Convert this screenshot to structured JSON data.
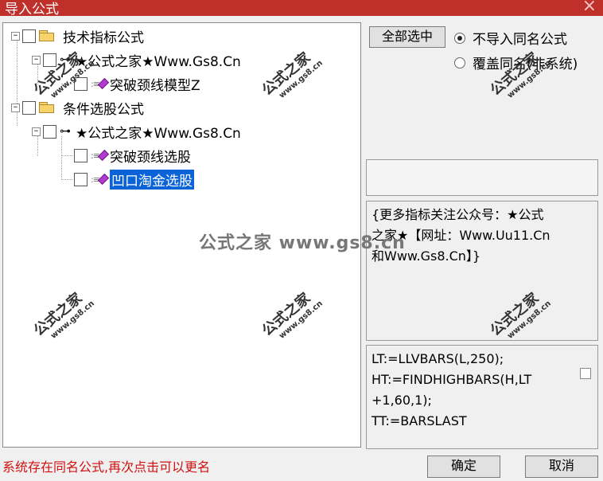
{
  "window": {
    "title": "导入公式",
    "close_glyph": "×"
  },
  "tree": {
    "items": [
      {
        "label": "技术指标公式",
        "type": "folder"
      },
      {
        "label": "★公式之家★Www.Gs8.Cn",
        "type": "group"
      },
      {
        "label": "突破颈线模型Z",
        "type": "formula"
      },
      {
        "label": "条件选股公式",
        "type": "folder"
      },
      {
        "label": "★公式之家★Www.Gs8.Cn",
        "type": "group"
      },
      {
        "label": "突破颈线选股",
        "type": "formula"
      },
      {
        "label": "凹口淘金选股",
        "type": "formula",
        "selected": true
      }
    ],
    "expander_glyph": "−"
  },
  "right": {
    "select_all_label": "全部选中",
    "radio_options": [
      {
        "label": "不导入同名公式",
        "checked": true
      },
      {
        "label": "覆盖同名(非系统)",
        "checked": false
      }
    ],
    "name_box_value": "",
    "description_lines": [
      "{更多指标关注公众号：★公式",
      "之家★【网址：Www.Uu11.Cn",
      "和Www.Gs8.Cn】}"
    ],
    "code_lines": [
      "LT:=LLVBARS(L,250);",
      "HT:=FINDHIGHBARS(H,LT",
      "+1,60,1);",
      "TT:=BARSLAST"
    ]
  },
  "status": {
    "message": "系统存在同名公式,再次点击可以更名"
  },
  "buttons": {
    "ok_label": "确定",
    "cancel_label": "取消"
  },
  "watermark": {
    "center_text": "公式之家 www.gs8.cn",
    "stamp_text": "公式之家",
    "stamp_url": "www.gs8.cn"
  },
  "colors": {
    "titlebar": "#c0302b",
    "selection": "#0a64d8",
    "status_text": "#d01010",
    "gem": "#b23ad0",
    "folder": "#f6d36b"
  }
}
